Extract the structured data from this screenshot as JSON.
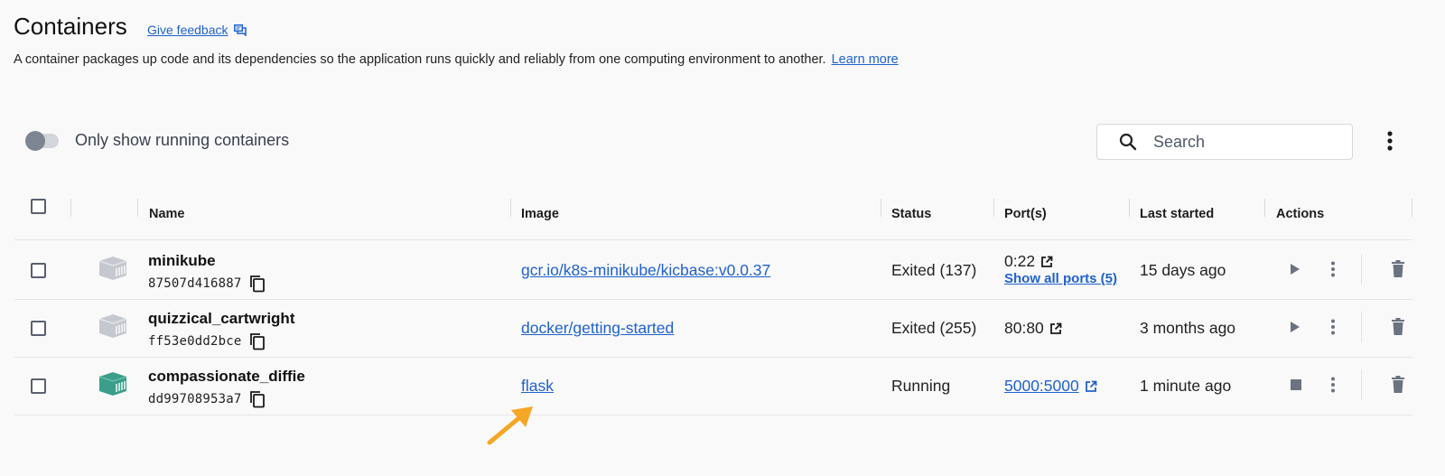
{
  "header": {
    "title": "Containers",
    "feedback_label": "Give feedback",
    "description": "A container packages up code and its dependencies so the application runs quickly and reliably from one computing environment to another.",
    "learn_more_label": "Learn more"
  },
  "toolbar": {
    "toggle_label": "Only show running containers",
    "toggle_on": false,
    "search_placeholder": "Search"
  },
  "table": {
    "columns": [
      "Name",
      "Image",
      "Status",
      "Port(s)",
      "Last started",
      "Actions"
    ],
    "rows": [
      {
        "name": "minikube",
        "id": "87507d416887",
        "image": "gcr.io/k8s-minikube/kicbase:v0.0.37",
        "status": "Exited (137)",
        "port": "0:22",
        "port_is_link": false,
        "show_ports_label": "Show all ports (5)",
        "last_started": "15 days ago",
        "running": false
      },
      {
        "name": "quizzical_cartwright",
        "id": "ff53e0dd2bce",
        "image": "docker/getting-started",
        "status": "Exited (255)",
        "port": "80:80",
        "port_is_link": false,
        "last_started": "3 months ago",
        "running": false
      },
      {
        "name": "compassionate_diffie",
        "id": "dd99708953a7",
        "image": "flask",
        "status": "Running",
        "port": "5000:5000",
        "port_is_link": true,
        "last_started": "1 minute ago",
        "running": true
      }
    ]
  },
  "colors": {
    "link": "#1f62cc",
    "running_icon": "#3a9e8a",
    "stopped_icon": "#c5c9cf",
    "annotation_arrow": "#f5a623"
  },
  "icons": [
    "feedback-icon",
    "search-icon",
    "more-vertical-icon",
    "container-icon",
    "copy-icon",
    "external-link-icon",
    "play-icon",
    "stop-icon",
    "trash-icon"
  ]
}
